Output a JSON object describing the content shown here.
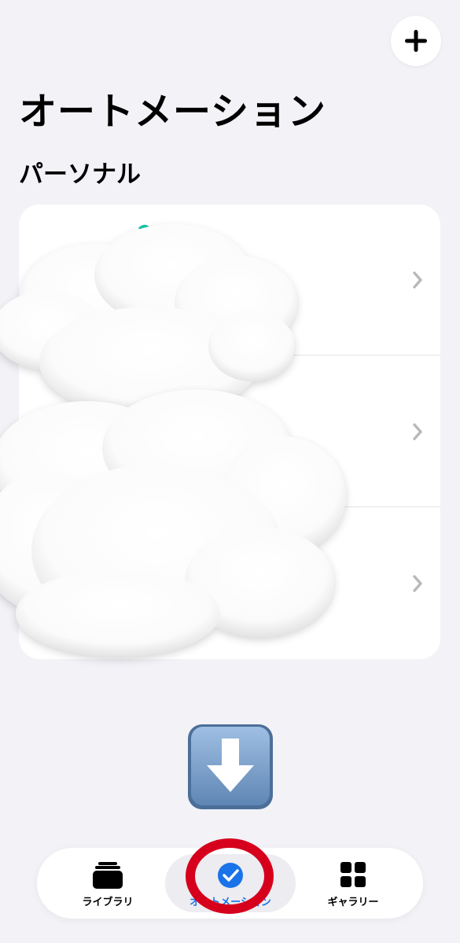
{
  "header": {
    "add_icon": "plus-icon",
    "title": "オートメーション"
  },
  "section": {
    "title": "パーソナル"
  },
  "automations": [
    {
      "label": "",
      "chevron_icon": "chevron-right-icon"
    },
    {
      "label": "",
      "chevron_icon": "chevron-right-icon"
    },
    {
      "label": "",
      "chevron_icon": "chevron-right-icon"
    }
  ],
  "overlay": {
    "arrow_icon": "down-arrow-emoji-icon",
    "highlight_color": "#d6001c"
  },
  "tabbar": {
    "tabs": [
      {
        "label": "ライブラリ",
        "icon": "library-stack-icon"
      },
      {
        "label": "オートメーション",
        "icon": "automation-clock-check-icon",
        "selected": true
      },
      {
        "label": "ギャラリー",
        "icon": "gallery-grid-icon"
      }
    ],
    "accent_color": "#1a73e8"
  }
}
